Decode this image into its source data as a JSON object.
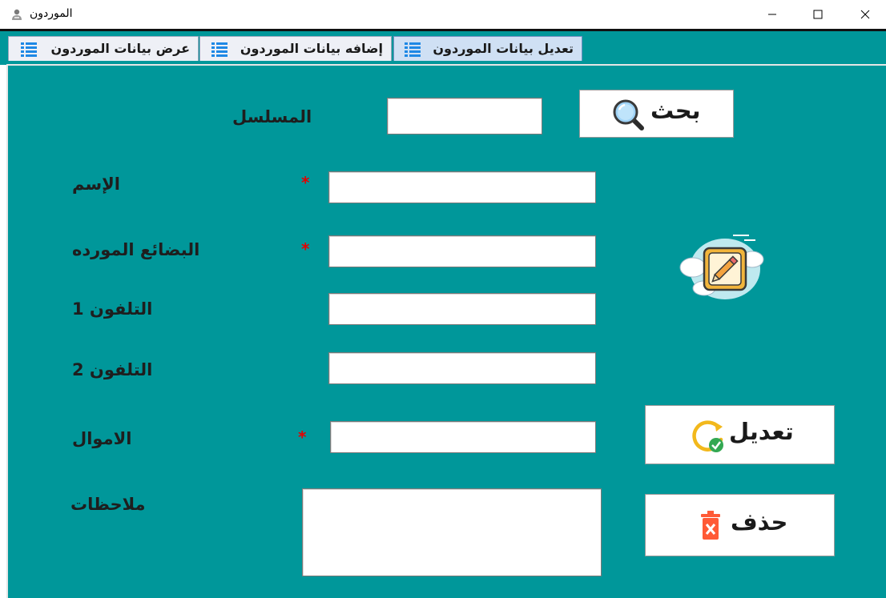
{
  "window": {
    "title": "الموردون",
    "app_icon": "user-icon",
    "controls": [
      "minimize-icon",
      "maximize-icon",
      "close-icon"
    ]
  },
  "tabs": [
    {
      "label": "تعديل بيانات الموردون",
      "icon": "list-icon",
      "active": true
    },
    {
      "label": "إضافه بيانات الموردون",
      "icon": "list-icon",
      "active": false
    },
    {
      "label": "عرض بيانات الموردون",
      "icon": "list-icon",
      "active": false
    }
  ],
  "form": {
    "serial_label": "المسلسل",
    "serial_value": "",
    "search_button": "بحث",
    "name_label": "الإسم",
    "name_value": "",
    "goods_label": "البضائع المورده",
    "goods_value": "",
    "phone1_label": "التلفون 1",
    "phone1_value": "",
    "phone2_label": "التلفون 2",
    "phone2_value": "",
    "money_label": "الاموال",
    "money_value": "",
    "notes_label": "ملاحظات",
    "notes_value": "",
    "required_mark": "*",
    "edit_button": "تعديل",
    "delete_button": "حذف"
  },
  "colors": {
    "panel_bg": "#00979a",
    "required": "#e30000",
    "active_tab": "#cfe0f4"
  }
}
